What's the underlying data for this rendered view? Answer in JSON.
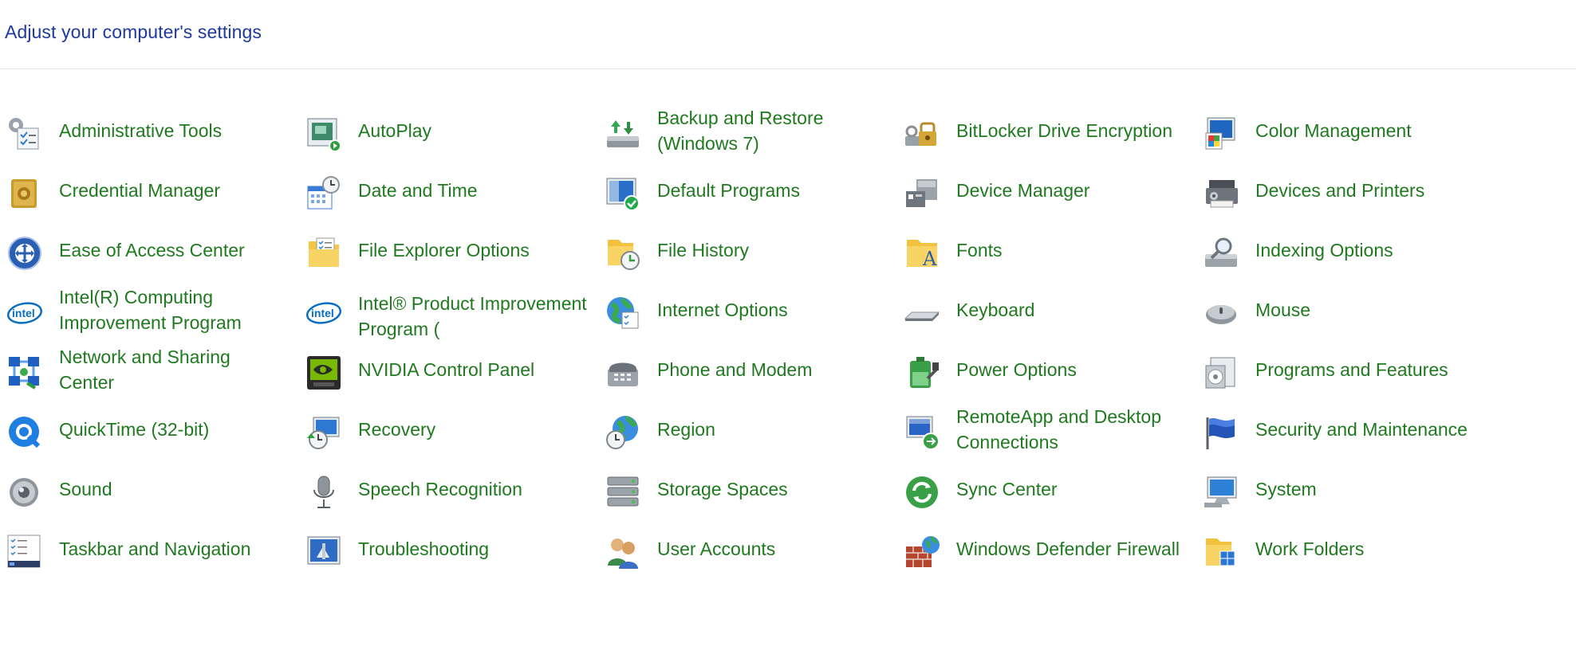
{
  "header": {
    "title": "Adjust your computer's settings"
  },
  "items": [
    {
      "label": "Administrative Tools",
      "icon": "administrative-tools-icon"
    },
    {
      "label": "AutoPlay",
      "icon": "autoplay-icon"
    },
    {
      "label": "Backup and Restore (Windows 7)",
      "icon": "backup-restore-icon"
    },
    {
      "label": "BitLocker Drive Encryption",
      "icon": "bitlocker-icon"
    },
    {
      "label": "Color Management",
      "icon": "color-management-icon"
    },
    {
      "label": "Credential Manager",
      "icon": "credential-manager-icon"
    },
    {
      "label": "Date and Time",
      "icon": "date-time-icon"
    },
    {
      "label": "Default Programs",
      "icon": "default-programs-icon"
    },
    {
      "label": "Device Manager",
      "icon": "device-manager-icon"
    },
    {
      "label": "Devices and Printers",
      "icon": "devices-printers-icon"
    },
    {
      "label": "Ease of Access Center",
      "icon": "ease-of-access-icon"
    },
    {
      "label": "File Explorer Options",
      "icon": "file-explorer-options-icon"
    },
    {
      "label": "File History",
      "icon": "file-history-icon"
    },
    {
      "label": "Fonts",
      "icon": "fonts-icon"
    },
    {
      "label": "Indexing Options",
      "icon": "indexing-options-icon"
    },
    {
      "label": "Intel(R) Computing Improvement Program",
      "icon": "intel-icon"
    },
    {
      "label": "Intel® Product Improvement Program (",
      "icon": "intel-icon"
    },
    {
      "label": "Internet Options",
      "icon": "internet-options-icon"
    },
    {
      "label": "Keyboard",
      "icon": "keyboard-icon"
    },
    {
      "label": "Mouse",
      "icon": "mouse-icon"
    },
    {
      "label": "Network and Sharing Center",
      "icon": "network-sharing-icon"
    },
    {
      "label": "NVIDIA Control Panel",
      "icon": "nvidia-icon"
    },
    {
      "label": "Phone and Modem",
      "icon": "phone-modem-icon"
    },
    {
      "label": "Power Options",
      "icon": "power-options-icon"
    },
    {
      "label": "Programs and Features",
      "icon": "programs-features-icon"
    },
    {
      "label": "QuickTime (32-bit)",
      "icon": "quicktime-icon"
    },
    {
      "label": "Recovery",
      "icon": "recovery-icon"
    },
    {
      "label": "Region",
      "icon": "region-icon"
    },
    {
      "label": "RemoteApp and Desktop Connections",
      "icon": "remoteapp-icon"
    },
    {
      "label": "Security and Maintenance",
      "icon": "security-maintenance-icon"
    },
    {
      "label": "Sound",
      "icon": "sound-icon"
    },
    {
      "label": "Speech Recognition",
      "icon": "speech-recognition-icon"
    },
    {
      "label": "Storage Spaces",
      "icon": "storage-spaces-icon"
    },
    {
      "label": "Sync Center",
      "icon": "sync-center-icon"
    },
    {
      "label": "System",
      "icon": "system-icon"
    },
    {
      "label": "Taskbar and Navigation",
      "icon": "taskbar-navigation-icon"
    },
    {
      "label": "Troubleshooting",
      "icon": "troubleshooting-icon"
    },
    {
      "label": "User Accounts",
      "icon": "user-accounts-icon"
    },
    {
      "label": "Windows Defender Firewall",
      "icon": "firewall-icon"
    },
    {
      "label": "Work Folders",
      "icon": "work-folders-icon"
    }
  ],
  "colors": {
    "title": "#1e3a9e",
    "link": "#1f7a1f",
    "divider": "#e3e3e3"
  }
}
